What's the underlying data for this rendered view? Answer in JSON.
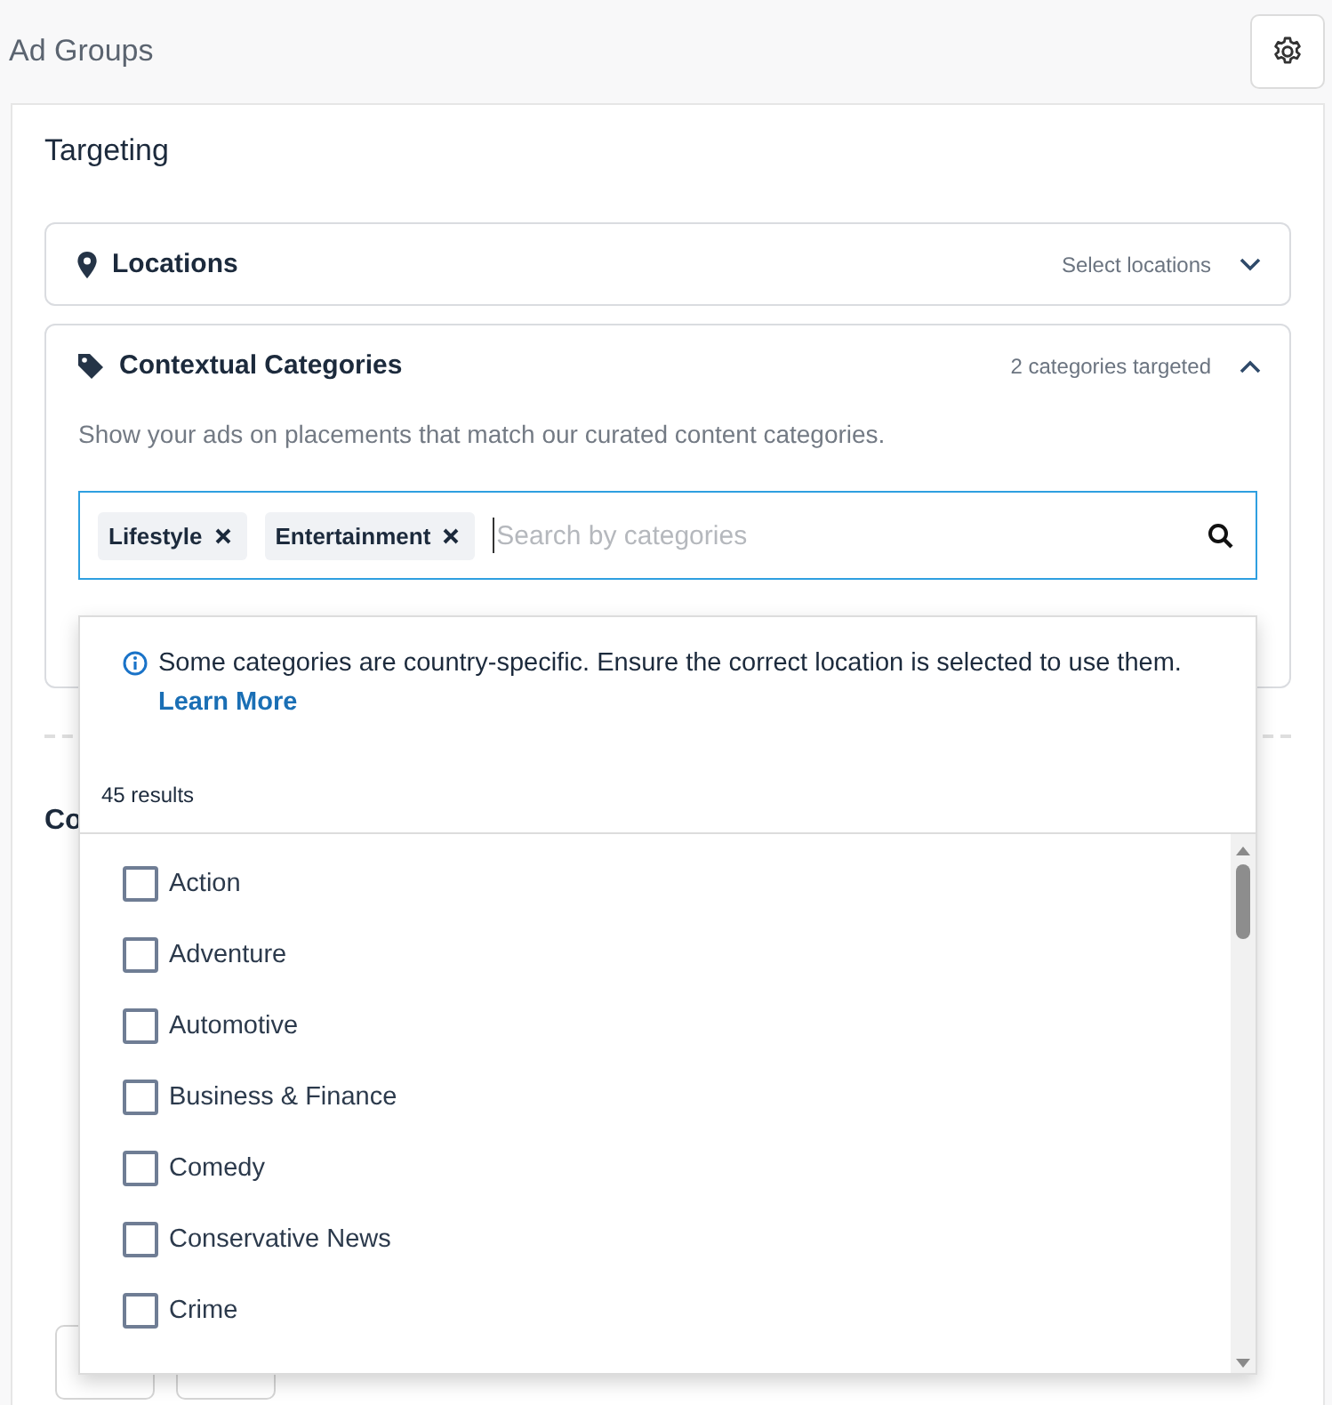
{
  "header": {
    "title": "Ad Groups"
  },
  "targeting": {
    "title": "Targeting",
    "sections": [
      {
        "kind": "locations",
        "title": "Locations",
        "summary": "Select locations",
        "expanded": false
      },
      {
        "kind": "categories",
        "title": "Contextual Categories",
        "summary": "2 categories targeted",
        "expanded": true,
        "description": "Show your ads on placements that match our curated content categories.",
        "tags": [
          {
            "label": "Lifestyle"
          },
          {
            "label": "Entertainment"
          }
        ],
        "search": {
          "placeholder": "Search by categories"
        },
        "dropdown": {
          "notice": "Some categories are country-specific. Ensure the correct location is selected to use them.",
          "link": "Learn More",
          "count": "45 results",
          "options": [
            {
              "label": "Action",
              "checked": false
            },
            {
              "label": "Adventure",
              "checked": false
            },
            {
              "label": "Automotive",
              "checked": false
            },
            {
              "label": "Business & Finance",
              "checked": false
            },
            {
              "label": "Comedy",
              "checked": false
            },
            {
              "label": "Conservative News",
              "checked": false
            },
            {
              "label": "Crime",
              "checked": false
            }
          ]
        }
      }
    ]
  },
  "next_section": {
    "title": "Co"
  }
}
